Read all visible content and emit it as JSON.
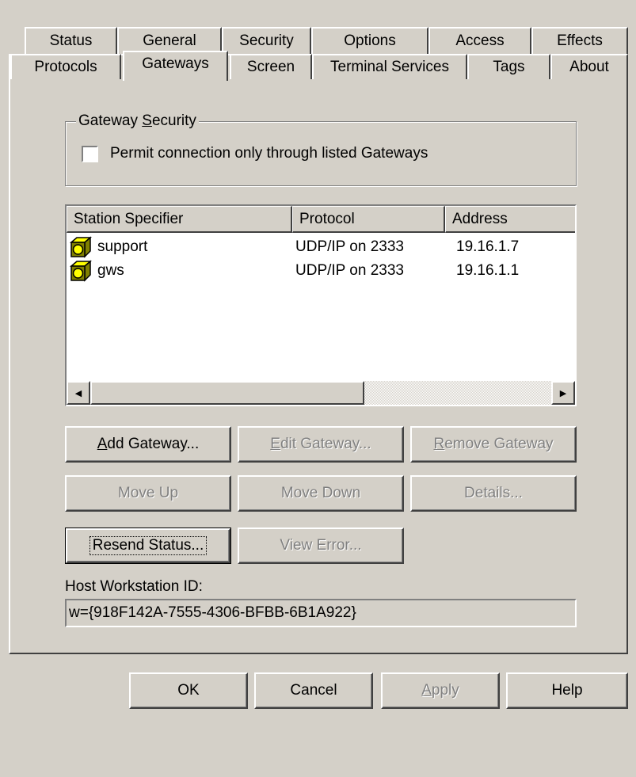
{
  "tabs": {
    "row1": [
      "Status",
      "General",
      "Security",
      "Options",
      "Access",
      "Effects"
    ],
    "row2": [
      "Protocols",
      "Gateways",
      "Screen",
      "Terminal Services",
      "Tags",
      "About"
    ],
    "active": "Gateways"
  },
  "gateway_security": {
    "legend_prefix": "Gateway ",
    "legend_mnemonic": "S",
    "legend_suffix": "ecurity",
    "checkbox_label": "Permit connection only through listed Gateways",
    "checked": false
  },
  "gateways_list": {
    "columns": [
      "Station Specifier",
      "Protocol",
      "Address"
    ],
    "rows": [
      {
        "name": "support",
        "protocol": "UDP/IP on 2333",
        "address": "19.16.1.7",
        "icon": "gateway-station-icon"
      },
      {
        "name": "gws",
        "protocol": "UDP/IP on 2333",
        "address": "19.16.1.1",
        "icon": "gateway-station-icon"
      }
    ]
  },
  "buttons": {
    "add_gateway": {
      "mn": "A",
      "rest": "dd Gateway..."
    },
    "edit_gateway": {
      "mn": "E",
      "rest": "dit Gateway..."
    },
    "remove_gateway": {
      "mn": "R",
      "rest": "emove Gateway"
    },
    "move_up": "Move Up",
    "move_down": "Move Down",
    "details": "Details...",
    "resend_status": "Resend Status...",
    "view_error": "View Error..."
  },
  "host_workstation": {
    "label": "Host Workstation ID:",
    "value": "w={918F142A-7555-4306-BFBB-6B1A922}"
  },
  "footer": {
    "ok": "OK",
    "cancel": "Cancel",
    "apply_mn": "A",
    "apply_rest": "pply",
    "help": "Help"
  },
  "colors": {
    "face": "#d4d0c8",
    "highlight": "#ffffff",
    "shadow": "#808080",
    "dark_shadow": "#404040",
    "icon_yellow": "#ffff00",
    "icon_olive": "#808000"
  }
}
